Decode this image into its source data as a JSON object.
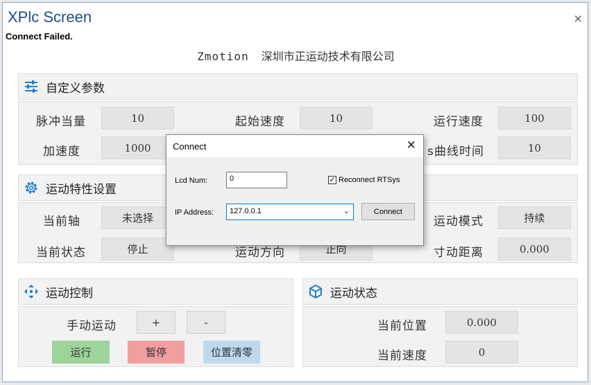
{
  "window": {
    "title": "XPlc Screen",
    "close_glyph": "×",
    "status_text": "Connect Failed."
  },
  "company": {
    "en": "Zmotion",
    "cn": "深圳市正运动技术有限公司"
  },
  "custom_params": {
    "header": "自定义参数",
    "icon": "sliders-icon",
    "fields": [
      {
        "label": "脉冲当量",
        "value": "10"
      },
      {
        "label": "起始速度",
        "value": "10"
      },
      {
        "label": "运行速度",
        "value": "100"
      },
      {
        "label": "加速度",
        "value": "1000"
      },
      {
        "label": "s曲线时间",
        "value": "10"
      }
    ]
  },
  "motion_settings": {
    "header": "运动特性设置",
    "icon": "gear-icon",
    "fields": [
      {
        "label": "当前轴",
        "value": "未选择"
      },
      {
        "label": "运动模式",
        "value": "持续"
      },
      {
        "label": "当前状态",
        "value": "停止"
      },
      {
        "label": "运动方向",
        "value": "正向"
      },
      {
        "label": "寸动距离",
        "value": "0.000"
      }
    ]
  },
  "motion_control": {
    "header": "运动控制",
    "icon": "move-icon",
    "manual_label": "手动运动",
    "plus_label": "+",
    "minus_label": "-",
    "run_label": "运行",
    "pause_label": "暂停",
    "zero_label": "位置清零",
    "colors": {
      "run": "#9ed39b",
      "pause": "#f19e9e",
      "zero": "#bcd9ee"
    }
  },
  "motion_status": {
    "header": "运动状态",
    "icon": "cube-icon",
    "fields": [
      {
        "label": "当前位置",
        "value": "0.000"
      },
      {
        "label": "当前速度",
        "value": "0"
      }
    ]
  },
  "dialog": {
    "title": "Connect",
    "close_glyph": "✕",
    "lcd_label": "Lcd Num:",
    "lcd_value": "0",
    "reconnect_label": "Reconnect RTSys",
    "reconnect_checked": true,
    "ip_label": "IP Address:",
    "ip_value": "127.0.0.1",
    "connect_label": "Connect"
  },
  "colors": {
    "accent": "#1f7fd0",
    "title": "#1f4f8a"
  }
}
